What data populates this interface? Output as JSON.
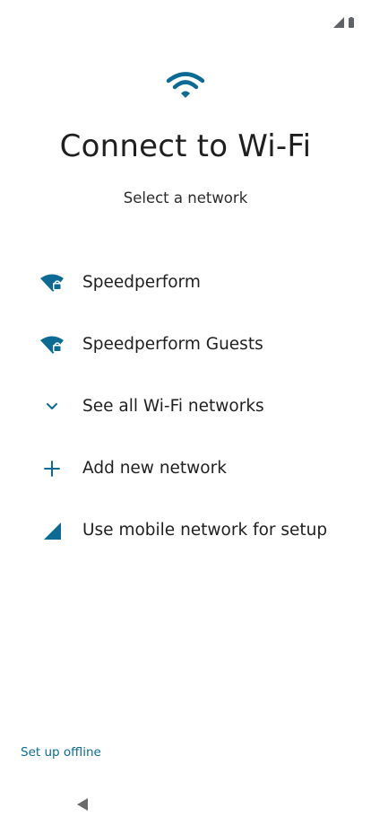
{
  "status_bar": {
    "icons": [
      "cellular-signal-icon",
      "battery-icon"
    ]
  },
  "header": {
    "icon": "wifi-icon",
    "title": "Connect to Wi-Fi",
    "subtitle": "Select a network"
  },
  "networks": [
    {
      "label": "Speedperform",
      "icon": "wifi-locked-icon"
    },
    {
      "label": "Speedperform Guests",
      "icon": "wifi-locked-icon"
    },
    {
      "label": "See all Wi-Fi networks",
      "icon": "chevron-down-icon"
    },
    {
      "label": "Add new network",
      "icon": "plus-icon"
    },
    {
      "label": "Use mobile network for setup",
      "icon": "mobile-signal-icon"
    }
  ],
  "footer": {
    "offline_label": "Set up offline"
  },
  "colors": {
    "accent": "#0b6b95",
    "text": "#1f1f1f",
    "icon_gray": "#5f6368"
  }
}
